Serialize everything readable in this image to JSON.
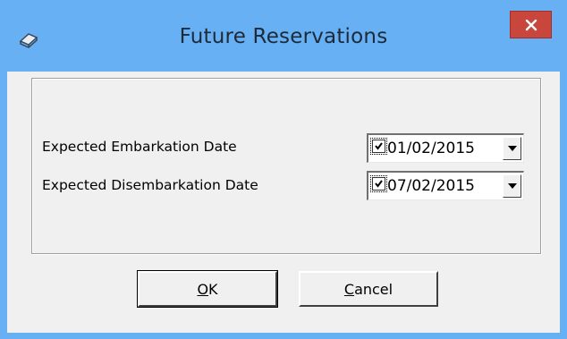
{
  "window": {
    "title": "Future Reservations",
    "close_icon": "close-icon",
    "app_icon": "book-icon"
  },
  "form": {
    "embark_label": "Expected Embarkation Date",
    "embark_date": "01/02/2015",
    "embark_checked": true,
    "disembark_label": "Expected Disembarkation Date",
    "disembark_date": "07/02/2015",
    "disembark_checked": true
  },
  "buttons": {
    "ok_mnemonic": "O",
    "ok_rest": "K",
    "cancel_mnemonic": "C",
    "cancel_rest": "ancel"
  }
}
